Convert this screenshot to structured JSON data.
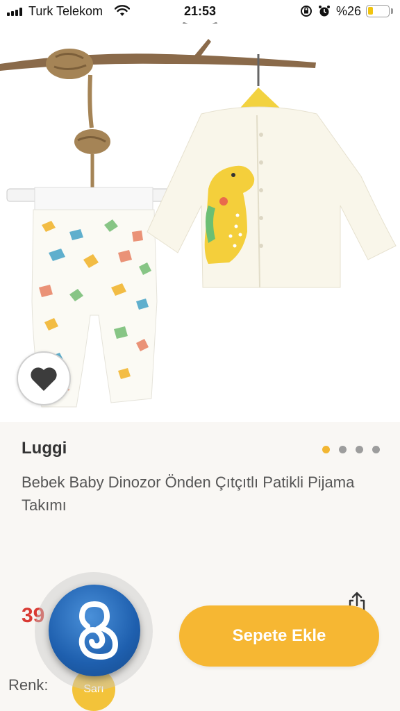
{
  "status_bar": {
    "carrier": "Turk Telekom",
    "time": "21:53",
    "battery_percent": "%26",
    "battery_level": 0.26,
    "icons": [
      "signal-icon",
      "wifi-icon",
      "rotation-lock-icon",
      "alarm-icon",
      "battery-icon"
    ]
  },
  "product": {
    "brand": "Luggi",
    "name": "Bebek Baby Dinozor Önden Çıtçıtlı Patikli Pijama Takımı",
    "price_partial": "39",
    "image_count": 4,
    "active_image": 1,
    "add_to_cart_label": "Sepete Ekle",
    "color_label": "Renk:",
    "color_value": "Sarı"
  },
  "colors": {
    "accent": "#f6b733",
    "price": "#d93a33",
    "panel_bg": "#f9f7f4",
    "overlay_button": "#1e5fae"
  }
}
